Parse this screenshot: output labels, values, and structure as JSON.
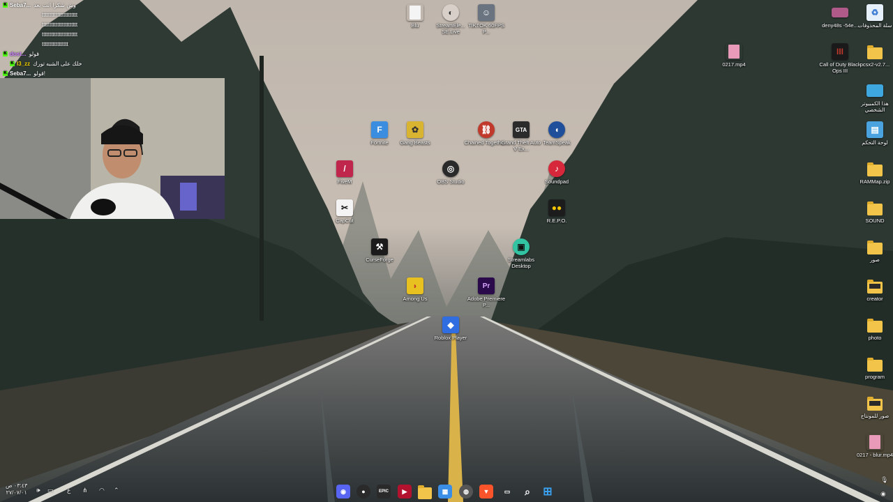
{
  "chat": {
    "lines": [
      {
        "user": "Seba7...",
        "text": "وش شكرا انت بعد",
        "color": "#ffffff"
      },
      {
        "user": "",
        "text": "ttttttttttttttttttttttt",
        "color": "#ffffff"
      },
      {
        "user": "",
        "text": "ttttttttttttttttttttttt",
        "color": "#ffffff"
      },
      {
        "user": "",
        "text": "ttttttttttttttttttttttt",
        "color": "#ffffff"
      },
      {
        "user": "",
        "text": "ttttttttttttttttt",
        "color": "#ffffff"
      },
      {
        "user": "dost...",
        "text": "قولو",
        "color": "#c77dff"
      },
      {
        "user": "I3_zz",
        "text": "خلك على الشبه تورك",
        "color": "#f5d300"
      },
      {
        "user": "Seba7...",
        "text": "قولو!",
        "color": "#ffffff"
      }
    ]
  },
  "desktop_icons": [
    {
      "name": "blu",
      "label": "Blu",
      "icon": "file-icon",
      "color": "#e8e8e8"
    },
    {
      "name": "streamelements",
      "label": "StreamEle... SE.Live",
      "icon": "streamelements-icon",
      "color": "#d8d0c8"
    },
    {
      "name": "tiktok",
      "label": "TIKTOK 60FPS P...",
      "icon": "tiktok-thumbnail-icon",
      "color": "#6a7380"
    },
    {
      "name": "deny48s",
      "label": "deny48s -54e...",
      "icon": "image-file-icon",
      "color": "#b05a8a"
    },
    {
      "name": "recycle-bin",
      "label": "سلة المحذوفات",
      "icon": "recycle-bin-icon",
      "color": "#e6f0fa"
    },
    {
      "name": "0217-mp4",
      "label": "0217.mp4",
      "icon": "video-file-icon",
      "color": "#e89ab8"
    },
    {
      "name": "cod-bo3",
      "label": "Call of Duty Black Ops III",
      "icon": "cod-icon",
      "color": "#c0392b"
    },
    {
      "name": "pcsx2",
      "label": "pcsx2-v2.7...",
      "icon": "folder-icon",
      "color": "#f2c44a"
    },
    {
      "name": "this-pc",
      "label": "هذا الكمبيوتر الشخصي",
      "icon": "monitor-icon",
      "color": "#3fa7e0"
    },
    {
      "name": "fortnite",
      "label": "Fortnite",
      "icon": "fortnite-icon",
      "color": "#3b8de0"
    },
    {
      "name": "gang-beasts",
      "label": "Gang Beasts",
      "icon": "gang-beasts-icon",
      "color": "#d9b430"
    },
    {
      "name": "chained-together",
      "label": "Chained Togethe...",
      "icon": "chained-together-icon",
      "color": "#c0392b"
    },
    {
      "name": "gta-v",
      "label": "Grand Theft Auto V Ex...",
      "icon": "gta-icon",
      "color": "#2b2b2b"
    },
    {
      "name": "teamspeak",
      "label": "TeamSpeak",
      "icon": "teamspeak-icon",
      "color": "#1f4e9a"
    },
    {
      "name": "control-panel",
      "label": "لوحة التحكم",
      "icon": "control-panel-icon",
      "color": "#4aa3df"
    },
    {
      "name": "fivem",
      "label": "FiveM",
      "icon": "fivem-icon",
      "color": "#c0264b"
    },
    {
      "name": "obs-studio",
      "label": "OBS Studio",
      "icon": "obs-icon",
      "color": "#2a2a2a"
    },
    {
      "name": "soundpad",
      "label": "Soundpad",
      "icon": "soundpad-icon",
      "color": "#d6283a"
    },
    {
      "name": "rammap",
      "label": "RAMMap.zip",
      "icon": "zip-folder-icon",
      "color": "#f2c44a"
    },
    {
      "name": "capcut",
      "label": "CapCut",
      "icon": "capcut-icon",
      "color": "#f4f4f4"
    },
    {
      "name": "repo",
      "label": "R.E.P.O.",
      "icon": "repo-icon",
      "color": "#1c1c1c"
    },
    {
      "name": "sound-folder",
      "label": "SOUND",
      "icon": "folder-icon",
      "color": "#f2c44a"
    },
    {
      "name": "curseforge",
      "label": "CurseForge",
      "icon": "curseforge-icon",
      "color": "#1b1b1b"
    },
    {
      "name": "streamlabs",
      "label": "Streamlabs Desktop",
      "icon": "streamlabs-icon",
      "color": "#31c3a2"
    },
    {
      "name": "photos-ar-folder",
      "label": "صور",
      "icon": "folder-icon",
      "color": "#f2c44a"
    },
    {
      "name": "among-us",
      "label": "Among Us",
      "icon": "among-us-icon",
      "color": "#e8c020"
    },
    {
      "name": "premiere-pro",
      "label": "Adobe Premiere P...",
      "icon": "premiere-icon",
      "color": "#2a0a4a"
    },
    {
      "name": "creator-folder",
      "label": "creator",
      "icon": "folder-icon",
      "color": "#f2c44a"
    },
    {
      "name": "roblox",
      "label": "Roblox Player",
      "icon": "roblox-icon",
      "color": "#2f6de0"
    },
    {
      "name": "photo-folder",
      "label": "photo",
      "icon": "folder-icon",
      "color": "#f2c44a"
    },
    {
      "name": "program-folder",
      "label": "program",
      "icon": "folder-icon",
      "color": "#f2c44a"
    },
    {
      "name": "montage-photos-folder",
      "label": "صور للمونتاج",
      "icon": "folder-icon",
      "color": "#f2c44a"
    },
    {
      "name": "0217-blur",
      "label": "0217 - blur.mp4",
      "icon": "video-file-icon",
      "color": "#e89ab8"
    }
  ],
  "taskbar": {
    "apps": [
      {
        "name": "discord",
        "icon": "discord-icon",
        "color": "#5865f2",
        "glyph": "◉"
      },
      {
        "name": "obs",
        "icon": "obs-icon",
        "color": "#2a2a2a",
        "glyph": "●"
      },
      {
        "name": "epic-games",
        "icon": "epic-games-icon",
        "color": "#2a2a2a",
        "glyph": "EPIC"
      },
      {
        "name": "video-editor",
        "icon": "video-editor-icon",
        "color": "#b3122e",
        "glyph": "▶"
      },
      {
        "name": "file-explorer",
        "icon": "folder-icon",
        "color": "#f2c44a",
        "glyph": ""
      },
      {
        "name": "microsoft-store",
        "icon": "store-icon",
        "color": "#3a8ee6",
        "glyph": "▦"
      },
      {
        "name": "chrome",
        "icon": "browser-icon",
        "color": "#555555",
        "glyph": "◍"
      },
      {
        "name": "brave",
        "icon": "brave-icon",
        "color": "#fb542b",
        "glyph": "▼"
      },
      {
        "name": "task-view",
        "icon": "task-view-icon",
        "color": "#ffffff",
        "glyph": "▭"
      },
      {
        "name": "search",
        "icon": "search-icon",
        "color": "#ffffff",
        "glyph": "⌕"
      },
      {
        "name": "start",
        "icon": "windows-start-icon",
        "color": "#3aa0f0",
        "glyph": "⊞"
      }
    ],
    "clock_time": "٠٣:٤٣ ص",
    "clock_date": "٢٧/٠٧/٠١",
    "language": "ع"
  }
}
